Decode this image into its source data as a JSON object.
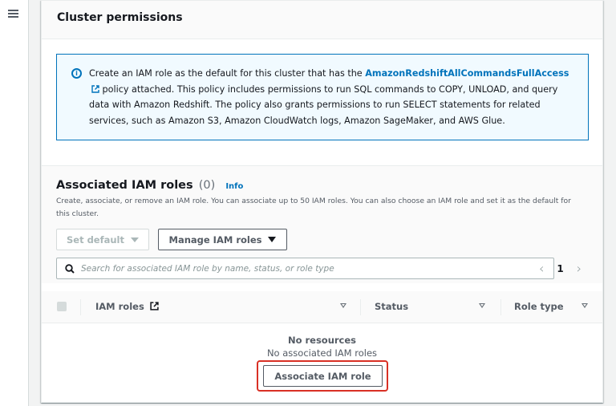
{
  "nav": {
    "menu_icon": "hamburger-menu-icon"
  },
  "panel": {
    "title": "Cluster permissions"
  },
  "info_alert": {
    "icon": "info-circle-icon",
    "text_before": "Create an IAM role as the default for this cluster that has the ",
    "policy_link": "AmazonRedshiftAllCommandsFullAccess",
    "link_icon": "external-link-icon",
    "text_after": " policy attached. This policy includes permissions to run SQL commands to COPY, UNLOAD, and query data with Amazon Redshift. The policy also grants permissions to run SELECT statements for related services, such as Amazon S3, Amazon CloudWatch logs, Amazon SageMaker, and AWS Glue."
  },
  "roles_section": {
    "title": "Associated IAM roles",
    "count": "(0)",
    "info_label": "Info",
    "description": "Create, associate, or remove an IAM role. You can associate up to 50 IAM roles. You can also choose an IAM role and set it as the default for this cluster.",
    "set_default_label": "Set default",
    "manage_label": "Manage IAM roles",
    "search_placeholder": "Search for associated IAM role by name, status, or role type",
    "search_value": "",
    "pagination": {
      "current_page": "1",
      "prev_icon": "chevron-left-icon",
      "next_icon": "chevron-right-icon"
    },
    "columns": [
      {
        "label": "IAM roles",
        "icon": "external-link-icon"
      },
      {
        "label": "Status"
      },
      {
        "label": "Role type"
      }
    ],
    "empty_title": "No resources",
    "empty_subtitle": "No associated IAM roles",
    "associate_label": "Associate IAM role"
  },
  "colors": {
    "accent": "#0073bb",
    "highlight": "#d93025",
    "info_bg": "#f1faff"
  }
}
